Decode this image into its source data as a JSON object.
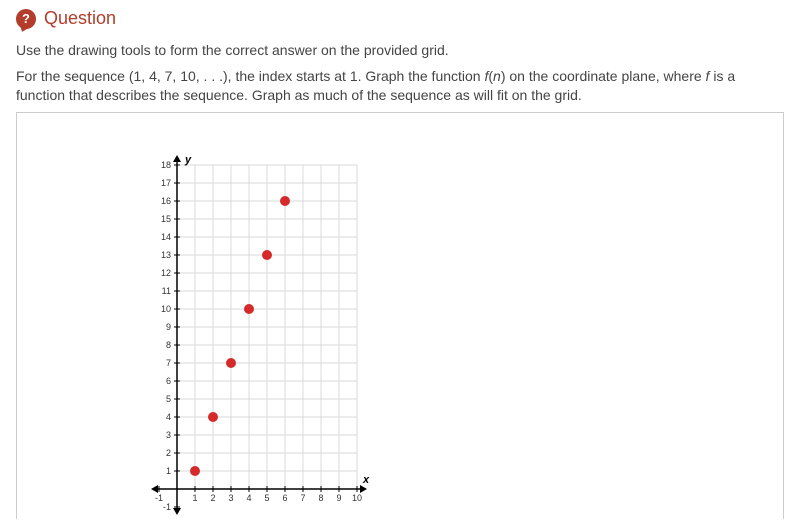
{
  "header": {
    "icon_glyph": "?",
    "title": "Question"
  },
  "instructions": {
    "line1": "Use the drawing tools to form the correct answer on the provided grid.",
    "line2_a": "For the sequence (1, 4, 7, 10, . . .), the index starts at 1. Graph the function ",
    "line2_fn": "f",
    "line2_b": "(",
    "line2_var": "n",
    "line2_c": ") on the coordinate plane, where ",
    "line2_f2": "f",
    "line2_d": " is a function that describes the sequence. Graph as much of the sequence as will fit on the grid."
  },
  "chart_data": {
    "type": "scatter",
    "xlabel": "x",
    "ylabel": "y",
    "xlim": [
      -1,
      10
    ],
    "ylim": [
      -1,
      18
    ],
    "x_ticks": [
      -1,
      1,
      2,
      3,
      4,
      5,
      6,
      7,
      8,
      9,
      10
    ],
    "y_ticks": [
      -1,
      1,
      2,
      3,
      4,
      5,
      6,
      7,
      8,
      9,
      10,
      11,
      12,
      13,
      14,
      15,
      16,
      17,
      18
    ],
    "points": [
      {
        "x": 1,
        "y": 1
      },
      {
        "x": 2,
        "y": 4
      },
      {
        "x": 3,
        "y": 7
      },
      {
        "x": 4,
        "y": 10
      },
      {
        "x": 5,
        "y": 13
      },
      {
        "x": 6,
        "y": 16
      }
    ]
  }
}
